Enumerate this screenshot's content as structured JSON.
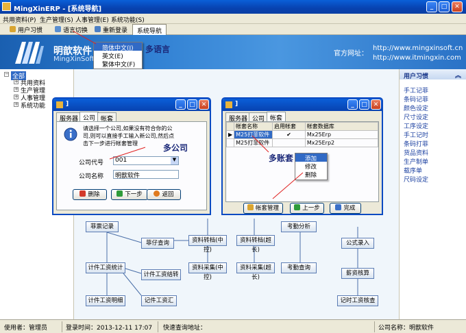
{
  "window": {
    "title": "MingXinERP - [系统导航]"
  },
  "menu": [
    "共用资料(P)",
    "生产管理(S)",
    "人事管理(E)",
    "系统功能(S)"
  ],
  "toolbar": {
    "habit": "用户习惯",
    "language": "语言切换",
    "relogin": "重新登录",
    "nav_tab": "系统导航"
  },
  "banner": {
    "brand": "明歆软件",
    "brand_en": "MingXinSoft",
    "site_label": "官方网址：",
    "url1": "http://www.mingxinsoft.cn",
    "url2": "http://www.itmingxin.com",
    "annotation": "多语言"
  },
  "language_menu": [
    "简体中文(J)",
    "英文(E)",
    "繁体中文(F)"
  ],
  "tree": {
    "root": "全部",
    "items": [
      "共用资料",
      "生产管理",
      "人事管理",
      "系统功能"
    ]
  },
  "right_panel": {
    "header": "用户习惯",
    "items": [
      "手工记菲",
      "条码记菲",
      "颜色设定",
      "尺寸设定",
      "工序设定",
      "手工记时",
      "条码打菲",
      "货品资料",
      "生产制单",
      "载序单",
      "尺码设定"
    ]
  },
  "flow_boxes": [
    "菲票记录",
    "菲仔查询",
    "计件工资统计",
    "计件工资结转",
    "计件工资明细",
    "记件工资汇",
    "资料转档(中控)",
    "资料转档(超长)",
    "资料采集(中控)",
    "资料采集(超长)",
    "考勤分析",
    "考勤查询",
    "公式录入",
    "薪资核算",
    "记时工资核查"
  ],
  "dialog1": {
    "title": "]",
    "tabs": [
      "服务器",
      "公司",
      "帐套"
    ],
    "message": "请选择一个公司,如果没有符合你的公司,则可以直接手工输入新公司,然后点击下一步进行帐套管理",
    "company_code_label": "公司代号",
    "company_code_value": "001",
    "company_name_label": "公司名称",
    "company_name_value": "明歆软件",
    "annotation": "多公司",
    "buttons": {
      "delete": "删除",
      "next": "下一步",
      "back": "返回"
    }
  },
  "dialog2": {
    "title": "]",
    "tabs": [
      "服务器",
      "公司",
      "帐套"
    ],
    "columns": [
      "帐套名称",
      "启用帐套",
      "帐套数据库"
    ],
    "rows": [
      {
        "name": "M25打菲软件",
        "enabled": "✔",
        "db": "Mx25Erp"
      },
      {
        "name": "M25打菲软件",
        "enabled": "",
        "db": "Mx25Erp2"
      }
    ],
    "annotation": "多账套",
    "context_menu": [
      "添加",
      "修改",
      "删除"
    ],
    "buttons": {
      "manage": "帐套管理",
      "prev": "上一步",
      "done": "完成"
    }
  },
  "status": {
    "user_label": "使用者：管理员",
    "login_label": "登录时间：2013-12-11 17:07",
    "query_label": "快速查询地址：",
    "company_label": "公司名称：明歆软件"
  }
}
